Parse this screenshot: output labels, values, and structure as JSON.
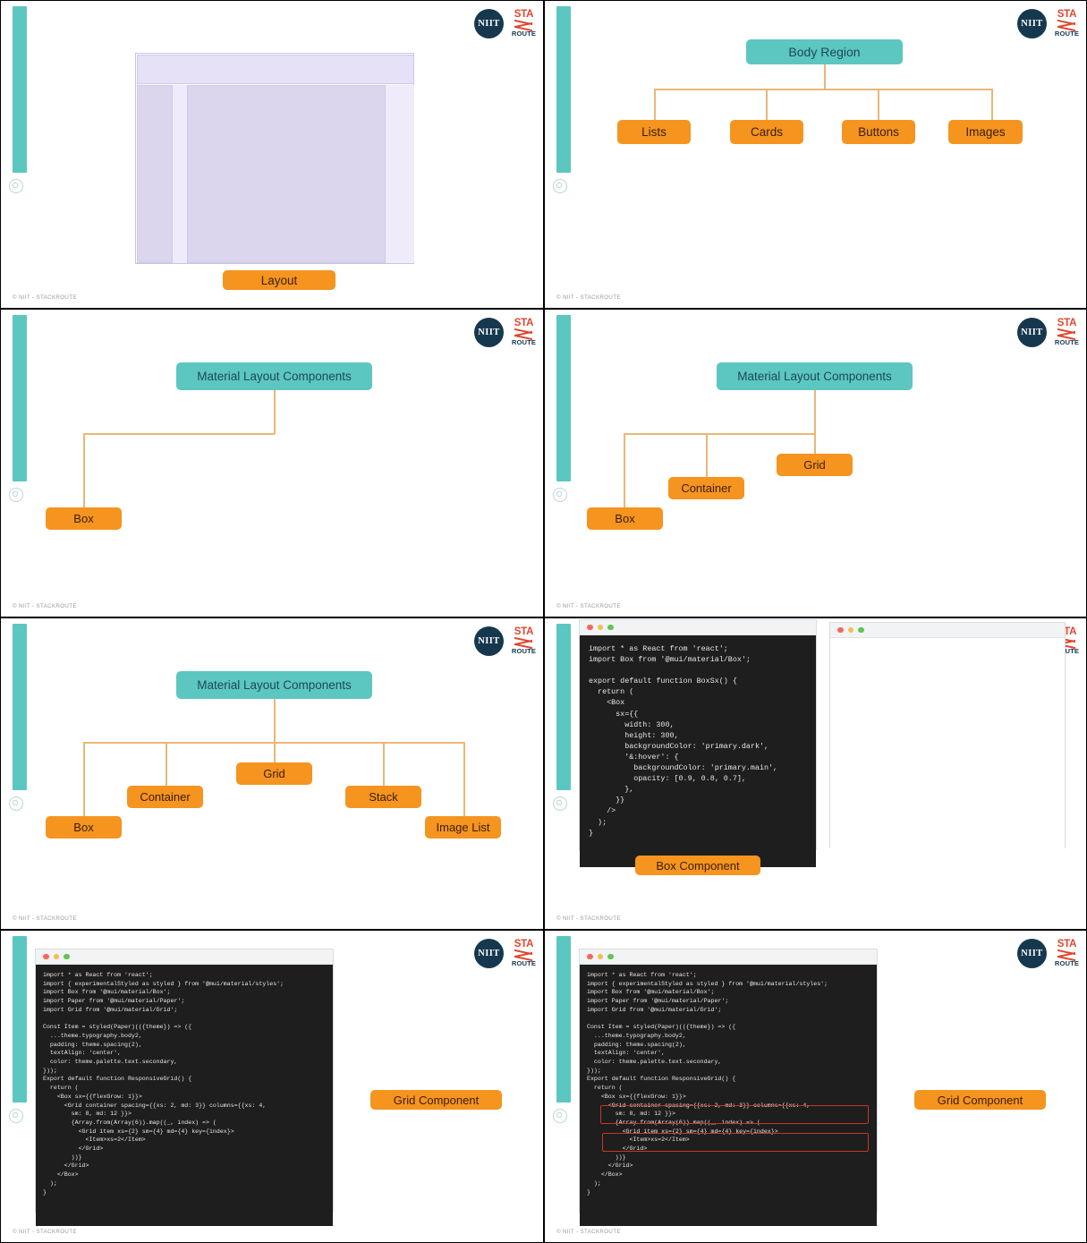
{
  "brand": {
    "niit": "NIIT",
    "stack_top": "STA",
    "stack_bottom": "ROUTE",
    "footer": "© NIIT - STACKROUTE",
    "teal": "#5cc6c0",
    "orange": "#f5941f",
    "navy": "#16384f",
    "red": "#e0452c",
    "connector": "#e8b877"
  },
  "slides": [
    {
      "id": "slide-layout",
      "caption": "Layout",
      "wireframe": {
        "header_label": "header-region",
        "left_column_label": "left-column",
        "main_label": "main-content",
        "right_column_label": "right-column"
      }
    },
    {
      "id": "slide-body-region",
      "root": "Body Region",
      "children": [
        "Lists",
        "Cards",
        "Buttons",
        "Images"
      ]
    },
    {
      "id": "slide-mlc-1",
      "root": "Material Layout Components",
      "children": [
        "Box"
      ]
    },
    {
      "id": "slide-mlc-2",
      "root": "Material Layout Components",
      "children": [
        "Box",
        "Container",
        "Grid"
      ]
    },
    {
      "id": "slide-mlc-3",
      "root": "Material Layout Components",
      "children": [
        "Box",
        "Container",
        "Grid",
        "Stack",
        "Image List"
      ]
    },
    {
      "id": "slide-box-component",
      "caption": "Box Component",
      "code": "import * as React from 'react';\nimport Box from '@mui/material/Box';\n\nexport default function BoxSx() {\n  return (\n    <Box\n      sx={{\n        width: 300,\n        height: 300,\n        backgroundColor: 'primary.dark',\n        '&:hover': {\n          backgroundColor: 'primary.main',\n          opacity: [0.9, 0.8, 0.7],\n        },\n      }}\n    />\n  );\n}",
      "preview_empty": true
    },
    {
      "id": "slide-grid-component",
      "caption": "Grid Component",
      "code": "import * as React from 'react';\nimport { experimentalStyled as styled } from '@mui/material/styles';\nimport Box from '@mui/material/Box';\nimport Paper from '@mui/material/Paper';\nimport Grid from '@mui/material/Grid';\n\nConst Item = styled(Paper)(({theme}) => ({\n  ...theme.typography.body2,\n  padding: theme.spacing(2),\n  textAlign: 'center',\n  color: theme.palette.text.secondary,\n}));\nExport default function ResponsiveGrid() {\n  return (\n    <Box sx={{flexGrow: 1}}>\n      <Grid container spacing={{xs: 2, md: 3}} columns={{xs: 4,\n        sm: 8, md: 12 }}>\n        {Array.from(Array(6)).map((_, index) => (\n          <Grid item xs={2} sm={4} md={4} key={index}>\n            <Item>xs=2</Item>\n          </Grid>\n        ))}\n      </Grid>\n    </Box>\n  );\n}",
      "highlights": []
    },
    {
      "id": "slide-grid-component-highlighted",
      "caption": "Grid Component",
      "code": "import * as React from 'react';\nimport { experimentalStyled as styled } from '@mui/material/styles';\nimport Box from '@mui/material/Box';\nimport Paper from '@mui/material/Paper';\nimport Grid from '@mui/material/Grid';\n\nConst Item = styled(Paper)(({theme}) => ({\n  ...theme.typography.body2,\n  padding: theme.spacing(2),\n  textAlign: 'center',\n  color: theme.palette.text.secondary,\n}));\nExport default function ResponsiveGrid() {\n  return (\n    <Box sx={{flexGrow: 1}}>\n      <Grid container spacing={{xs: 2, md: 3}} columns={{xs: 4,\n        sm: 8, md: 12 }}>\n        {Array.from(Array(6)).map((_, index) => (\n          <Grid item xs={2} sm={4} md={4} key={index}>\n            <Item>xs=2</Item>\n          </Grid>\n        ))}\n      </Grid>\n    </Box>\n  );\n}",
      "highlights": [
        {
          "label": "grid-container-highlight"
        },
        {
          "label": "grid-item-highlight"
        }
      ]
    }
  ]
}
